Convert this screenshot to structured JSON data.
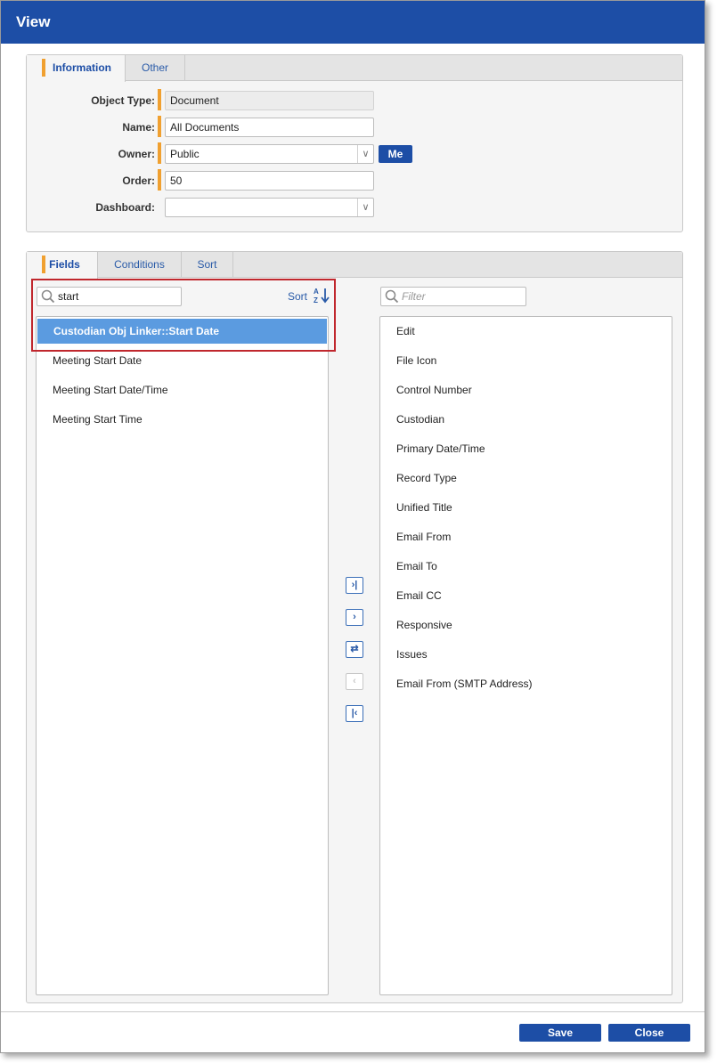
{
  "window": {
    "title": "View"
  },
  "info_tabs": [
    {
      "label": "Information"
    },
    {
      "label": "Other"
    }
  ],
  "form": {
    "object_type": {
      "label": "Object Type:",
      "value": "Document"
    },
    "name": {
      "label": "Name:",
      "value": "All Documents"
    },
    "owner": {
      "label": "Owner:",
      "value": "Public",
      "me_button": "Me"
    },
    "order": {
      "label": "Order:",
      "value": "50"
    },
    "dashboard": {
      "label": "Dashboard:",
      "value": ""
    }
  },
  "field_tabs": [
    {
      "label": "Fields"
    },
    {
      "label": "Conditions"
    },
    {
      "label": "Sort"
    }
  ],
  "available": {
    "search_value": "start",
    "sort_label": "Sort",
    "items": [
      {
        "label": "Custodian Obj Linker::Start Date",
        "selected": true
      },
      {
        "label": "Meeting Start Date"
      },
      {
        "label": "Meeting Start Date/Time"
      },
      {
        "label": "Meeting Start Time"
      }
    ]
  },
  "selected": {
    "filter_placeholder": "Filter",
    "items": [
      {
        "label": "Edit"
      },
      {
        "label": "File Icon"
      },
      {
        "label": "Control Number"
      },
      {
        "label": "Custodian"
      },
      {
        "label": "Primary Date/Time"
      },
      {
        "label": "Record Type"
      },
      {
        "label": "Unified Title"
      },
      {
        "label": "Email From"
      },
      {
        "label": "Email To"
      },
      {
        "label": "Email CC"
      },
      {
        "label": "Responsive"
      },
      {
        "label": "Issues"
      },
      {
        "label": "Email From (SMTP Address)"
      }
    ]
  },
  "move_buttons": [
    {
      "icon": "move-all-right-icon",
      "glyph": "›|",
      "enabled": true
    },
    {
      "icon": "move-right-icon",
      "glyph": "›",
      "enabled": true
    },
    {
      "icon": "swap-icon",
      "glyph": "⇄",
      "enabled": true
    },
    {
      "icon": "move-left-icon",
      "glyph": "‹",
      "enabled": false
    },
    {
      "icon": "move-all-left-icon",
      "glyph": "|‹",
      "enabled": true
    }
  ],
  "footer": {
    "save_label": "Save",
    "close_label": "Close"
  },
  "colors": {
    "titlebar": "#1d4ea6",
    "accent": "#f0a030",
    "selection": "#5b9be0",
    "highlight": "#c0272d"
  }
}
